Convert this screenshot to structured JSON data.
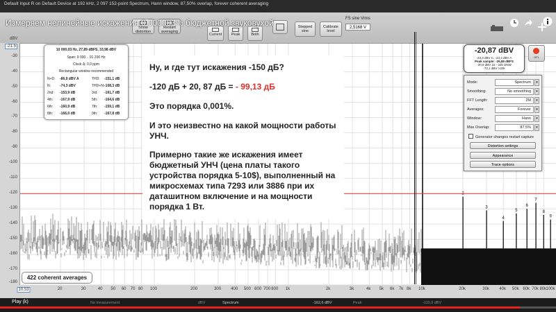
{
  "window": {
    "title": "Default Input R on Default Device at 192 kHz, 2 097 152-point Spectrum, Hann window, 87,50% overlap, forever coherent averaging",
    "video_title": "Измеряем нелинейные искажения 0.000003% бюджетной звуковухой"
  },
  "toolbar": {
    "buttons": [
      {
        "label": "Show distortion",
        "name": "show-distortion-button"
      },
      {
        "label": "Restart averaging",
        "name": "restart-averaging-button"
      },
      {
        "label": "Current",
        "name": "current-button"
      },
      {
        "label": "Peak",
        "name": "peak-button"
      },
      {
        "label": "Both",
        "name": "both-button"
      },
      {
        "label": "Stepped sine",
        "name": "stepped-sine-button"
      },
      {
        "label": "Calibrate level",
        "name": "calibrate-level-button"
      }
    ],
    "fs_label": "FS sine Vrms",
    "fs_value": "2,5168 V"
  },
  "readout": {
    "header": "10 000,03 Hz, 27,89 dBFS, 33,98 dBV",
    "span": "Span: 9 000 .. 91 200 Hz",
    "clock": "Clock Δ: 0,0 ppm",
    "window_note": "Rectangular window recommended",
    "rows": [
      {
        "k1": "N+D:",
        "v1": "-86,9 dBV A",
        "k2": "THD:",
        "v2": "-151,1 dB"
      },
      {
        "k1": "N:",
        "v1": "-74,3 dBV",
        "k2": "THD+N:",
        "v2": "-108,3 dB"
      },
      {
        "k1": "2nd:",
        "v1": "-153,9 dB",
        "k2": "3rd:",
        "v2": "-161,7 dB"
      },
      {
        "k1": "4th:",
        "v1": "-167,9 dB",
        "k2": "5th:",
        "v2": "-164,6 dB"
      },
      {
        "k1": "6th:",
        "v1": "-160,9 dB",
        "k2": "7th:",
        "v2": "-159,1 dB"
      },
      {
        "k1": "8th:",
        "v1": "-166,0 dB",
        "k2": "9th:",
        "v2": "-167,8 dB"
      }
    ]
  },
  "level": {
    "big": "-20,87 dBV",
    "l1": "-23,3 dBV C, -23,4 dBV A",
    "l2": "Peak sample: -26,89 dBFS",
    "l3": "-20,9 dBV 22 - 22k UNW",
    "l4": "-72,1 dBV >22k"
  },
  "overflow": {
    "label": "OFL"
  },
  "settings": {
    "rows": [
      {
        "k": "Mode:",
        "v": "Spectrum"
      },
      {
        "k": "Smoothing:",
        "v": "No smoothing"
      },
      {
        "k": "FFT Length:",
        "v": "2M"
      },
      {
        "k": "Averages:",
        "v": "Forever"
      },
      {
        "k": "Window:",
        "v": "Hann"
      },
      {
        "k": "Max Overlap:",
        "v": "87.5%"
      }
    ],
    "checkbox": "Generator changes restart capture",
    "buttons": [
      "Distortion settings",
      "Appearance",
      "Trace options"
    ]
  },
  "averages_label": "422 coherent averages",
  "annotation": {
    "line1": "Ну, и где тут искажения -150 дБ?",
    "line2a": "-120 дБ + 20, 87 дБ = ",
    "line2b": " - 99,13 дБ",
    "line3": "Это порядка 0,001%.",
    "line4": "И это неизвестно на какой мощности работы УНЧ.",
    "line5": "Примерно такие же искажения имеет бюджетный УНЧ (цена платы такого устройства порядка 5-10$), выполненный на микросхемах типа 7293 или 3886 при их даташитном включение и на мощности порядка 1 Вт."
  },
  "status": {
    "play": "Play (k)",
    "no_measurement": "No measurement",
    "unit": "dBV",
    "spectrum": "Spectrum",
    "spectrum_value": "-162,6 dBV",
    "peak": "Peak",
    "peak_value": "-110,9 dBV"
  },
  "colors": {
    "trace": "#111111",
    "accent_red": "#e0302a",
    "annotation_line": "#e0302a"
  },
  "chart_data": {
    "type": "line",
    "xscale": "log",
    "xlim": [
      10,
      100000
    ],
    "ylim": [
      -180,
      -21.5
    ],
    "ylabel": "dBV",
    "y_top_tick": "-21.5",
    "y_ticks": [
      "-30",
      "-40",
      "-50",
      "-60",
      "-70",
      "-80",
      "-90",
      "-100",
      "-110",
      "-120",
      "-130",
      "-140",
      "-150",
      "-160",
      "-170",
      "-180"
    ],
    "x_left_tick": "10,53",
    "x_ticks": [
      "20",
      "30",
      "40",
      "50",
      "60",
      "70",
      "80",
      "100",
      "200",
      "300",
      "400",
      "500",
      "600",
      "700",
      "800",
      "1k",
      "2k",
      "3k",
      "4k",
      "5k",
      "6k",
      "7k",
      "8k",
      "10k",
      "20k",
      "30k",
      "40k",
      "50k",
      "60k",
      "70k",
      "80k",
      "100k"
    ],
    "fundamental": {
      "freq_hz": 10000,
      "level_dbv": -20.87
    },
    "noise_floor_dbv": -165,
    "harmonics": [
      {
        "n": "2",
        "freq_hz": 20000,
        "level_dbv": -122
      },
      {
        "n": "3",
        "freq_hz": 30000,
        "level_dbv": -131
      },
      {
        "n": "4",
        "freq_hz": 40000,
        "level_dbv": -138
      },
      {
        "n": "5",
        "freq_hz": 50000,
        "level_dbv": -133
      },
      {
        "n": "6",
        "freq_hz": 60000,
        "level_dbv": -130
      },
      {
        "n": "7",
        "freq_hz": 70000,
        "level_dbv": -126
      },
      {
        "n": "8",
        "freq_hz": 80000,
        "level_dbv": -134
      },
      {
        "n": "9",
        "freq_hz": 90000,
        "level_dbv": -137
      }
    ],
    "reference_lines_dbv": [
      -120
    ],
    "grid": true
  }
}
